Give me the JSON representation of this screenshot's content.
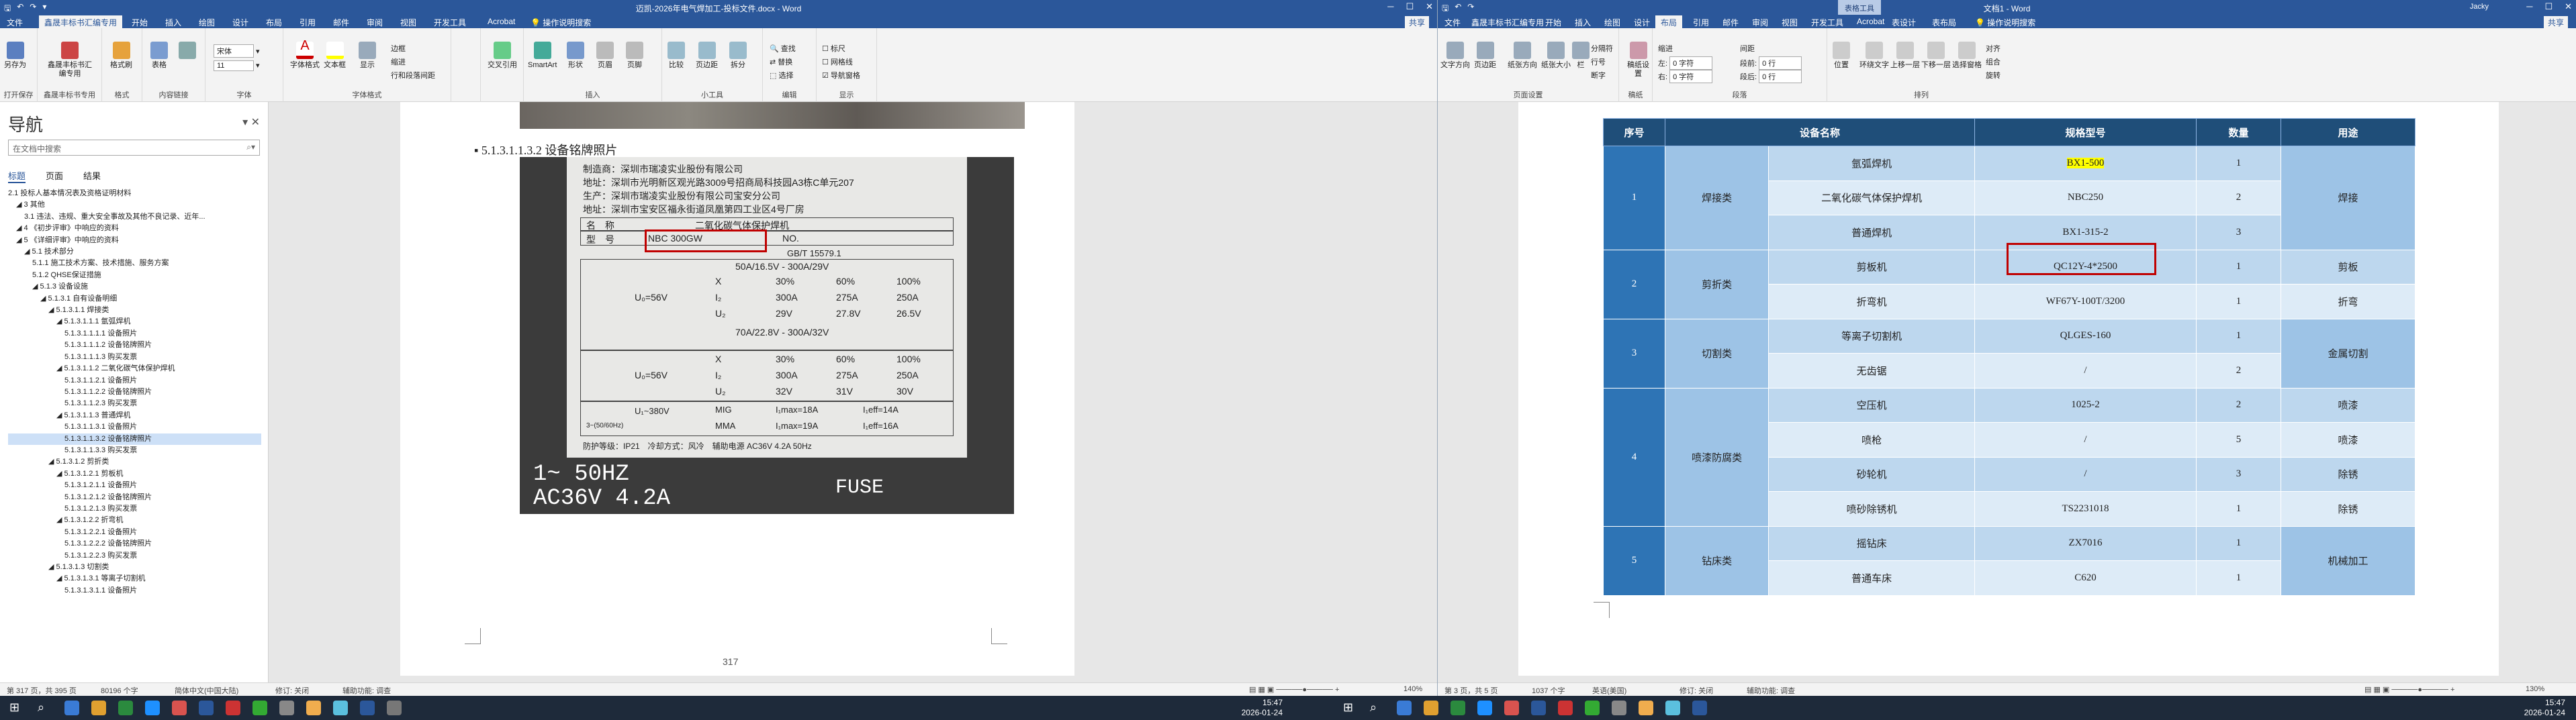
{
  "left_window": {
    "title": "迈凯-2026年电气焊加工-投标文件.docx - Word",
    "tabs": [
      "文件",
      "鑫晟丰标书汇编专用",
      "开始",
      "插入",
      "绘图",
      "设计",
      "布局",
      "引用",
      "邮件",
      "审阅",
      "视图",
      "开发工具",
      "Acrobat"
    ],
    "active_tab": "鑫晟丰标书汇编专用",
    "tell_me": "操作说明搜索",
    "share": "共享",
    "ribbon": {
      "groups": [
        "打开保存",
        "鑫晟丰标书专用",
        "格式",
        "内容链接",
        "字体",
        "字体格式",
        "",
        "交叉引用",
        "插入",
        "小工具",
        "编辑",
        "显示"
      ],
      "save_as": "另存为",
      "mgr": "鑫晟丰标书汇编专用",
      "format_brush": "格式刷",
      "table": "表格",
      "font_name": "宋体",
      "font_size": "11",
      "font_fx": "字体格式",
      "text_frame": "文本框",
      "paragraph": "显示",
      "border": "边框",
      "indent": "缩进",
      "line_spacing": "行和段落间距",
      "cross_ref": "交叉引用",
      "smartart": "SmartArt",
      "shape": "形状",
      "page": "页眉",
      "footer": "页脚",
      "contrast": "比较",
      "page_fit": "页边距",
      "split": "拆分",
      "find": "查找",
      "replace": "替换",
      "select": "选择",
      "ruler": "标尺",
      "gridlines": "网格线",
      "nav_pane": "导航窗格"
    },
    "nav": {
      "title": "导航",
      "search_placeholder": "在文档中搜索",
      "tabs": [
        "标题",
        "页面",
        "结果"
      ],
      "items": [
        {
          "text": "2.1 投标人基本情况表及资格证明材料",
          "indent": 0,
          "sel": false
        },
        {
          "text": "◢ 3 其他",
          "indent": 1,
          "sel": false
        },
        {
          "text": "3.1 违法、违规、重大安全事故及其他不良记录、近年...",
          "indent": 2,
          "sel": false
        },
        {
          "text": "◢ 4 《初步评审》中响应的资料",
          "indent": 1,
          "sel": false
        },
        {
          "text": "◢ 5 《详细评审》中响应的资料",
          "indent": 1,
          "sel": false
        },
        {
          "text": "◢ 5.1 技术部分",
          "indent": 2,
          "sel": false
        },
        {
          "text": "5.1.1 施工技术方案、技术措施、服务方案",
          "indent": 3,
          "sel": false
        },
        {
          "text": "5.1.2 QHSE保证措施",
          "indent": 3,
          "sel": false
        },
        {
          "text": "◢ 5.1.3 设备设施",
          "indent": 3,
          "sel": false
        },
        {
          "text": "◢ 5.1.3.1 自有设备明细",
          "indent": 4,
          "sel": false
        },
        {
          "text": "◢ 5.1.3.1.1 焊接类",
          "indent": 5,
          "sel": false
        },
        {
          "text": "◢ 5.1.3.1.1.1 氩弧焊机",
          "indent": 6,
          "sel": false
        },
        {
          "text": "5.1.3.1.1.1.1 设备照片",
          "indent": 7,
          "sel": false
        },
        {
          "text": "5.1.3.1.1.1.2 设备铭牌照片",
          "indent": 7,
          "sel": false
        },
        {
          "text": "5.1.3.1.1.1.3 购买发票",
          "indent": 7,
          "sel": false
        },
        {
          "text": "◢ 5.1.3.1.1.2 二氧化碳气体保护焊机",
          "indent": 6,
          "sel": false
        },
        {
          "text": "5.1.3.1.1.2.1 设备照片",
          "indent": 7,
          "sel": false
        },
        {
          "text": "5.1.3.1.1.2.2 设备铭牌照片",
          "indent": 7,
          "sel": false
        },
        {
          "text": "5.1.3.1.1.2.3 购买发票",
          "indent": 7,
          "sel": false
        },
        {
          "text": "◢ 5.1.3.1.1.3 普通焊机",
          "indent": 6,
          "sel": false
        },
        {
          "text": "5.1.3.1.1.3.1 设备照片",
          "indent": 7,
          "sel": false
        },
        {
          "text": "5.1.3.1.1.3.2 设备铭牌照片",
          "indent": 7,
          "sel": true
        },
        {
          "text": "5.1.3.1.1.3.3 购买发票",
          "indent": 7,
          "sel": false
        },
        {
          "text": "◢ 5.1.3.1.2 剪折类",
          "indent": 5,
          "sel": false
        },
        {
          "text": "◢ 5.1.3.1.2.1 剪板机",
          "indent": 6,
          "sel": false
        },
        {
          "text": "5.1.3.1.2.1.1 设备照片",
          "indent": 7,
          "sel": false
        },
        {
          "text": "5.1.3.1.2.1.2 设备铭牌照片",
          "indent": 7,
          "sel": false
        },
        {
          "text": "5.1.3.1.2.1.3 购买发票",
          "indent": 7,
          "sel": false
        },
        {
          "text": "◢ 5.1.3.1.2.2 折弯机",
          "indent": 6,
          "sel": false
        },
        {
          "text": "5.1.3.1.2.2.1 设备照片",
          "indent": 7,
          "sel": false
        },
        {
          "text": "5.1.3.1.2.2.2 设备铭牌照片",
          "indent": 7,
          "sel": false
        },
        {
          "text": "5.1.3.1.2.2.3 购买发票",
          "indent": 7,
          "sel": false
        },
        {
          "text": "◢ 5.1.3.1.3 切割类",
          "indent": 5,
          "sel": false
        },
        {
          "text": "◢ 5.1.3.1.3.1 等离子切割机",
          "indent": 6,
          "sel": false
        },
        {
          "text": "5.1.3.1.3.1.1 设备照片",
          "indent": 7,
          "sel": false
        }
      ]
    },
    "doc": {
      "heading": "5.1.3.1.1.3.2 设备铭牌照片",
      "page_number": "317",
      "nameplate": {
        "maker": "制造商：深圳市瑞凌实业股份有限公司",
        "addr1": "地址：深圳市光明新区观光路3009号招商局科技园A3栋C单元207",
        "producer": "生产：深圳市瑞凌实业股份有限公司宝安分公司",
        "addr2": "地址：深圳市宝安区福永街道凤凰第四工业区4号厂房",
        "name_label": "名　称",
        "name_value": "二氧化碳气体保护焊机",
        "model_label": "型　号",
        "model_value": "NBC 300GW",
        "no_label": "NO.",
        "std": "GB/T 15579.1",
        "r1": "50A/16.5V - 300A/29V",
        "r2": "70A/22.8V - 300A/32V",
        "x": "X",
        "i2": "I₂",
        "u2": "U₂",
        "u0a": "U₀=56V",
        "u0b": "U₀=56V",
        "c30": "30%",
        "c60": "60%",
        "c100": "100%",
        "a300": "300A",
        "a275": "275A",
        "a250": "250A",
        "v29": "29V",
        "v278": "27.8V",
        "v265": "26.5V",
        "v32": "32V",
        "v31": "31V",
        "v30": "30V",
        "u1": "U₁~380V",
        "mig": "MIG",
        "mma": "MMA",
        "i1max_a": "I₁max=18A",
        "i1eff_a": "I₁eff=14A",
        "i1max_b": "I₁max=19A",
        "i1eff_b": "I₁eff=16A",
        "hz": "3~(50/60Hz)",
        "foot": "防护等级：IP21　冷却方式：风冷　辅助电源 AC36V 4.2A 50Hz",
        "big1": "1~ 50HZ",
        "big2": "AC36V 4.2A",
        "fuse": "FUSE"
      }
    },
    "status": {
      "page": "第 317 页，共 395 页",
      "words": "80196 个字",
      "lang": "简体中文(中国大陆)",
      "track": "修订: 关闭",
      "access": "辅助功能: 调查",
      "zoom": "140%"
    }
  },
  "right_window": {
    "title": "文档1 - Word",
    "context": "表格工具",
    "user": "Jacky",
    "tabs": [
      "文件",
      "鑫晟丰标书汇编专用",
      "开始",
      "插入",
      "绘图",
      "设计",
      "布局",
      "引用",
      "邮件",
      "审阅",
      "视图",
      "开发工具",
      "Acrobat",
      "表设计",
      "表布局"
    ],
    "active_tab": "布局",
    "tell_me": "操作说明搜索",
    "share": "共享",
    "ribbon": {
      "groups": [
        "页面设置",
        "稿纸",
        "段落",
        "排列"
      ],
      "margins": "文字方向",
      "orient": "页边距",
      "size": "纸张方向",
      "columns": "纸张大小",
      "breaks": "栏",
      "grid_paper": "稿纸设置",
      "indent": "缩进",
      "spacing": "间距",
      "left": "左:",
      "right": "右:",
      "before": "段前:",
      "after": "段后:",
      "left_val": "0 字符",
      "right_val": "0 字符",
      "before_val": "0 行",
      "after_val": "0 行",
      "position": "位置",
      "wrap": "环绕文字",
      "forward": "上移一层",
      "backward": "下移一层",
      "sel_pane": "选择窗格",
      "align": "对齐",
      "group": "组合",
      "rotate": "旋转",
      "breaks_label": "分隔符",
      "line_numbers": "行号",
      "hyphen": "断字"
    },
    "table": {
      "headers": [
        "序号",
        "设备名称",
        "规格型号",
        "数量",
        "用途"
      ],
      "groups": [
        {
          "no": "1",
          "cat": "焊接类",
          "use": "焊接",
          "rows": [
            {
              "name": "氩弧焊机",
              "spec": "BX1-500",
              "qty": "1",
              "hl": true
            },
            {
              "name": "二氧化碳气体保护焊机",
              "spec": "NBC250",
              "qty": "2",
              "hl": false
            },
            {
              "name": "普通焊机",
              "spec": "BX1-315-2",
              "qty": "3",
              "hl": false
            }
          ]
        },
        {
          "no": "2",
          "cat": "剪折类",
          "use": "",
          "rows": [
            {
              "name": "剪板机",
              "spec": "QC12Y-4*2500",
              "qty": "1",
              "use": "剪板",
              "hl": false
            },
            {
              "name": "折弯机",
              "spec": "WF67Y-100T/3200",
              "qty": "1",
              "use": "折弯",
              "hl": false
            }
          ]
        },
        {
          "no": "3",
          "cat": "切割类",
          "use": "金属切割",
          "rows": [
            {
              "name": "等离子切割机",
              "spec": "QLGES-160",
              "qty": "1",
              "hl": false
            },
            {
              "name": "无齿锯",
              "spec": "/",
              "qty": "2",
              "hl": false
            }
          ]
        },
        {
          "no": "4",
          "cat": "喷漆防腐类",
          "use": "",
          "rows": [
            {
              "name": "空压机",
              "spec": "1025-2",
              "qty": "2",
              "use": "喷漆",
              "hl": false
            },
            {
              "name": "喷枪",
              "spec": "/",
              "qty": "5",
              "use": "喷漆",
              "hl": false
            },
            {
              "name": "砂轮机",
              "spec": "/",
              "qty": "3",
              "use": "除锈",
              "hl": false
            },
            {
              "name": "喷砂除锈机",
              "spec": "TS2231018",
              "qty": "1",
              "use": "除锈",
              "hl": false
            }
          ]
        },
        {
          "no": "5",
          "cat": "钻床类",
          "use": "机械加工",
          "rows": [
            {
              "name": "摇钻床",
              "spec": "ZX7016",
              "qty": "1",
              "hl": false
            },
            {
              "name": "普通车床",
              "spec": "C620",
              "qty": "1",
              "hl": false
            }
          ]
        }
      ]
    },
    "status": {
      "page": "第 3 页，共 5 页",
      "words": "1037 个字",
      "lang": "英语(美国)",
      "track": "修订: 关闭",
      "access": "辅助功能: 调查",
      "zoom": "130%"
    }
  },
  "taskbar": {
    "time_left": "15:47",
    "date_left": "2026-01-24",
    "time_right": "15:47",
    "date_right": "2026-01-24"
  }
}
